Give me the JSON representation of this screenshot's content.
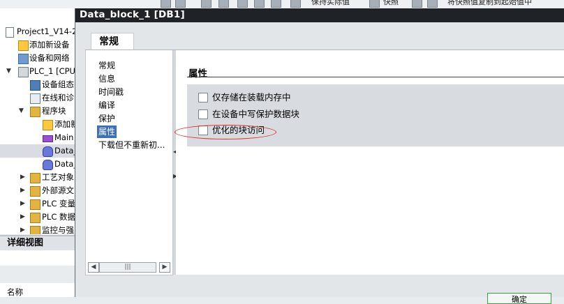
{
  "toolbar": {
    "keep_actual": "保持实际值",
    "snapshot": "快照",
    "copy_snapshot": "将快照值复制到起始值中"
  },
  "tree": {
    "items": [
      {
        "label": "Project1_V14-2"
      },
      {
        "label": "添加新设备"
      },
      {
        "label": "设备和网络"
      },
      {
        "label": "PLC_1 [CPU"
      },
      {
        "label": "设备组态"
      },
      {
        "label": "在线和诊"
      },
      {
        "label": "程序块"
      },
      {
        "label": "添加新"
      },
      {
        "label": "Main"
      },
      {
        "label": "Data_"
      },
      {
        "label": "Data_"
      },
      {
        "label": "工艺对象"
      },
      {
        "label": "外部源文"
      },
      {
        "label": "PLC 变量"
      },
      {
        "label": "PLC 数据"
      },
      {
        "label": "监控与强"
      }
    ]
  },
  "detail_view": {
    "title": "详细视图",
    "column_name": "名称"
  },
  "dialog": {
    "title": "Data_block_1 [DB1]",
    "tab": "常规",
    "nav": [
      {
        "label": "常规"
      },
      {
        "label": "信息"
      },
      {
        "label": "时间戳"
      },
      {
        "label": "编译"
      },
      {
        "label": "保护"
      },
      {
        "label": "属性",
        "selected": true
      },
      {
        "label": "下载但不重新初..."
      }
    ],
    "section_title": "属性",
    "options": [
      {
        "label": "仅存储在装载内存中",
        "checked": false
      },
      {
        "label": "在设备中写保护数据块",
        "checked": false
      },
      {
        "label": "优化的块访问",
        "checked": false
      }
    ],
    "ok_button": "确定"
  },
  "icons": {
    "scroll_left": "chevron-left-icon",
    "scroll_right": "chevron-right-icon",
    "grip": "scroll-grip-icon"
  },
  "colors": {
    "titlebar": "#1f2327",
    "selection": "#3c6fb6",
    "annotation": "#e0282a",
    "ok_border": "#35a23a"
  }
}
